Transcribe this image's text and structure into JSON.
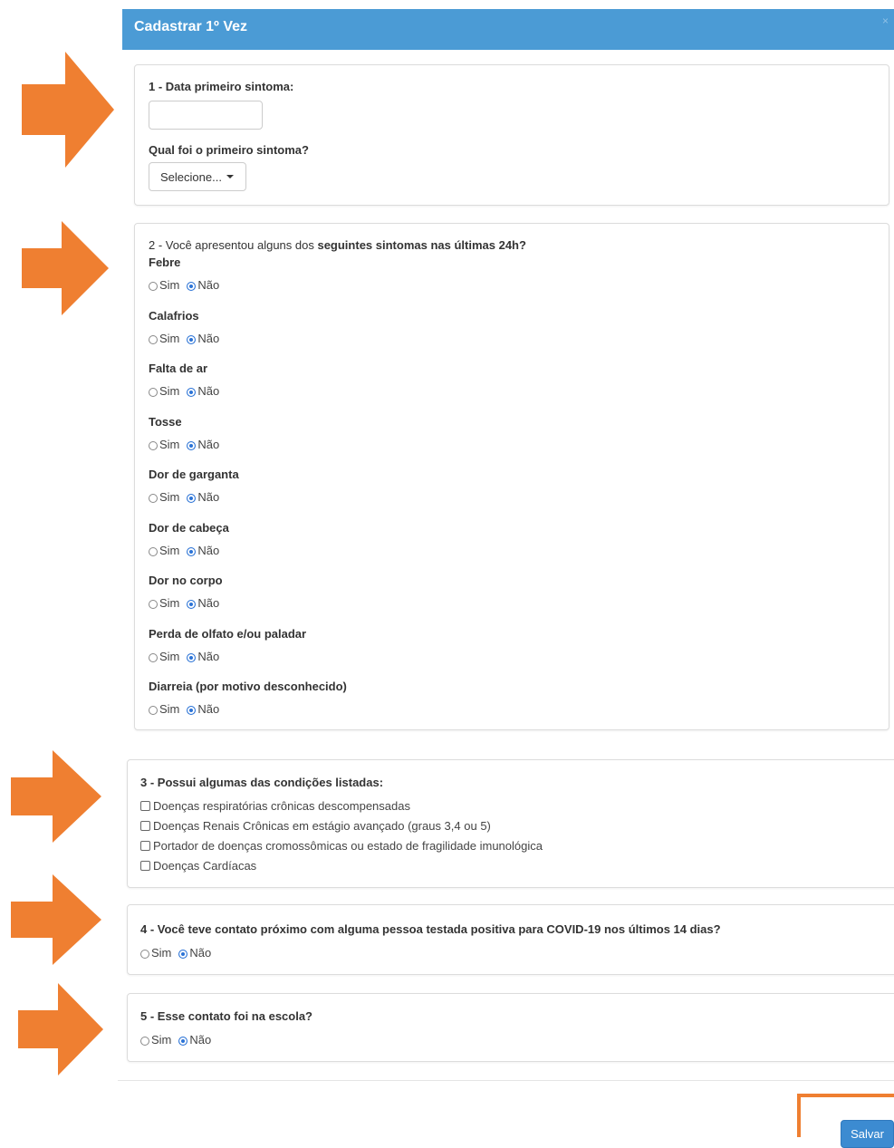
{
  "modal": {
    "title": "Cadastrar 1º Vez",
    "close": "×"
  },
  "colors": {
    "header": "#4b9bd5",
    "arrow": "#ef7f31",
    "radio_selected": "#2b73d6",
    "save_button": "#3c8bd1"
  },
  "section1": {
    "label": "1 - Data primeiro sintoma:",
    "date_value": "",
    "symptom_question": "Qual foi o primeiro sintoma?",
    "select_value": "Selecione..."
  },
  "section2": {
    "intro_normal": "2 - Você apresentou alguns dos ",
    "intro_bold": "seguintes sintomas nas últimas 24h?",
    "symptoms": [
      {
        "name": "Febre",
        "selected": "Não"
      },
      {
        "name": "Calafrios",
        "selected": "Não"
      },
      {
        "name": "Falta de ar",
        "selected": "Não"
      },
      {
        "name": "Tosse",
        "selected": "Não"
      },
      {
        "name": "Dor de garganta",
        "selected": "Não"
      },
      {
        "name": "Dor de cabeça",
        "selected": "Não"
      },
      {
        "name": "Dor no corpo",
        "selected": "Não"
      },
      {
        "name": "Perda de olfato e/ou paladar",
        "selected": "Não"
      },
      {
        "name": "Diarreia (por motivo desconhecido)",
        "selected": "Não"
      }
    ]
  },
  "radio_options": {
    "yes": "Sim",
    "no": "Não"
  },
  "section3": {
    "label": "3 - Possui algumas das condições listadas:",
    "conditions": [
      "Doenças respiratórias crônicas descompensadas",
      "Doenças Renais Crônicas em estágio avançado (graus 3,4 ou 5)",
      "Portador de doenças cromossômicas ou estado de fragilidade imunológica",
      "Doenças Cardíacas"
    ]
  },
  "section4": {
    "label": "4 - Você teve contato próximo com alguma pessoa testada positiva para COVID-19 nos últimos 14 dias?",
    "selected": "Não"
  },
  "section5": {
    "label": "5 - Esse contato foi na escola?",
    "selected": "Não"
  },
  "footer": {
    "save_label": "Salvar"
  }
}
